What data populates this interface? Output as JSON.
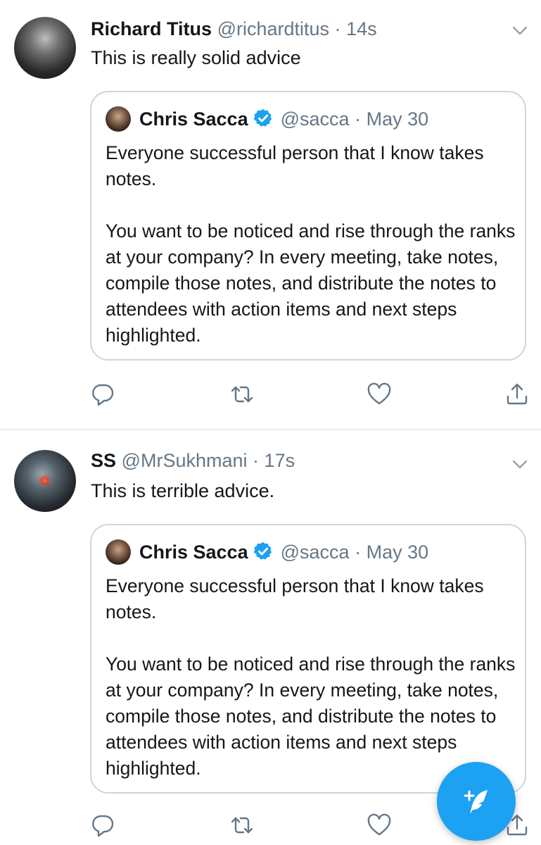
{
  "tweets": [
    {
      "author_name": "Richard Titus",
      "handle": "@richardtitus",
      "separator": "·",
      "time": "14s",
      "text": "This is really solid advice",
      "quote": {
        "author_name": "Chris Sacca",
        "handle": "@sacca",
        "separator": "·",
        "date": "May 30",
        "paragraph_1": "Everyone successful person that I know takes notes.",
        "paragraph_2": "You want to be noticed and rise through the ranks at your company? In every meeting, take notes, compile those notes, and distribute the notes to attendees with action items and next steps highlighted."
      }
    },
    {
      "author_name": "SS",
      "handle": "@MrSukhmani",
      "separator": "·",
      "time": "17s",
      "text": "This is terrible advice.",
      "quote": {
        "author_name": "Chris Sacca",
        "handle": "@sacca",
        "separator": "·",
        "date": "May 30",
        "paragraph_1": "Everyone successful person that I know takes notes.",
        "paragraph_2": "You want to be noticed and rise through the ranks at your company? In every meeting, take notes, compile those notes, and distribute the notes to attendees with action items and next steps highlighted."
      }
    }
  ],
  "icons": {
    "reply": "reply-icon",
    "retweet": "retweet-icon",
    "like": "heart-icon",
    "share": "share-icon",
    "more": "chevron-down-icon",
    "verified": "verified-badge-icon",
    "compose": "compose-tweet-icon"
  },
  "colors": {
    "accent": "#1da1f2",
    "secondary_text": "#657786",
    "border": "#ccd6dd",
    "divider": "#e6ecf0"
  }
}
